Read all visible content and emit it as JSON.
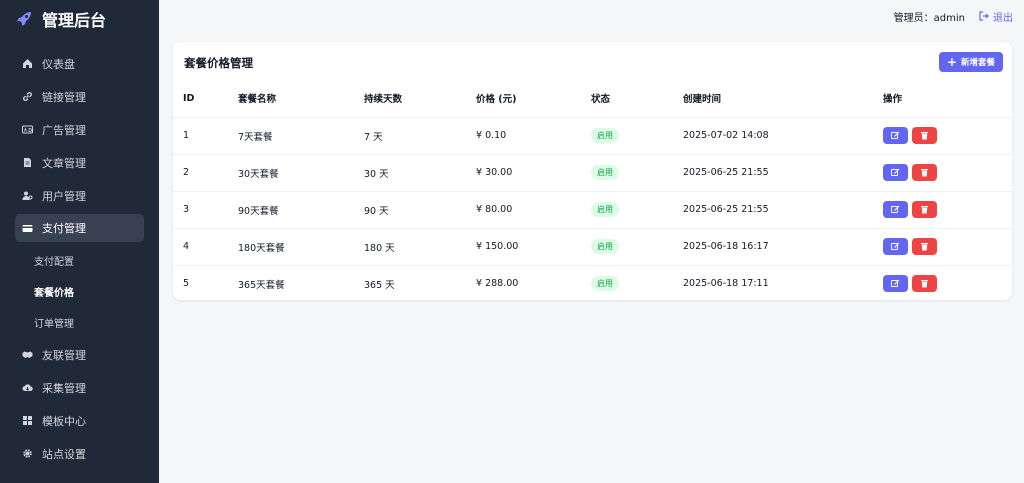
{
  "brand": {
    "title": "管理后台"
  },
  "topbar": {
    "admin_label": "管理员：admin",
    "logout_label": "退出"
  },
  "sidebar": {
    "items": [
      {
        "label": "仪表盘",
        "icon": "home-icon"
      },
      {
        "label": "链接管理",
        "icon": "link-icon"
      },
      {
        "label": "广告管理",
        "icon": "ad-icon"
      },
      {
        "label": "文章管理",
        "icon": "file-icon"
      },
      {
        "label": "用户管理",
        "icon": "users-icon"
      },
      {
        "label": "支付管理",
        "icon": "credit-card-icon",
        "active": true
      },
      {
        "label": "友联管理",
        "icon": "handshake-icon"
      },
      {
        "label": "采集管理",
        "icon": "cloud-download-icon"
      },
      {
        "label": "模板中心",
        "icon": "grid-icon"
      },
      {
        "label": "站点设置",
        "icon": "gear-icon"
      }
    ],
    "sub_items": [
      {
        "label": "支付配置"
      },
      {
        "label": "套餐价格",
        "active": true
      },
      {
        "label": "订单管理"
      }
    ]
  },
  "main": {
    "title": "套餐价格管理",
    "add_button": "新增套餐",
    "columns": [
      "ID",
      "套餐名称",
      "持续天数",
      "价格 (元)",
      "状态",
      "创建时间",
      "操作"
    ],
    "rows": [
      {
        "id": "1",
        "name": "7天套餐",
        "days": "7 天",
        "price": "¥ 0.10",
        "status": "启用",
        "created": "2025-07-02 14:08"
      },
      {
        "id": "2",
        "name": "30天套餐",
        "days": "30 天",
        "price": "¥ 30.00",
        "status": "启用",
        "created": "2025-06-25 21:55"
      },
      {
        "id": "3",
        "name": "90天套餐",
        "days": "90 天",
        "price": "¥ 80.00",
        "status": "启用",
        "created": "2025-06-25 21:55"
      },
      {
        "id": "4",
        "name": "180天套餐",
        "days": "180 天",
        "price": "¥ 150.00",
        "status": "启用",
        "created": "2025-06-18 16:17"
      },
      {
        "id": "5",
        "name": "365天套餐",
        "days": "365 天",
        "price": "¥ 288.00",
        "status": "启用",
        "created": "2025-06-18 17:11"
      }
    ]
  },
  "colors": {
    "sidebar_bg": "#1f2937",
    "accent": "#6366f1",
    "danger": "#ef4444",
    "success": "#16a34a"
  }
}
